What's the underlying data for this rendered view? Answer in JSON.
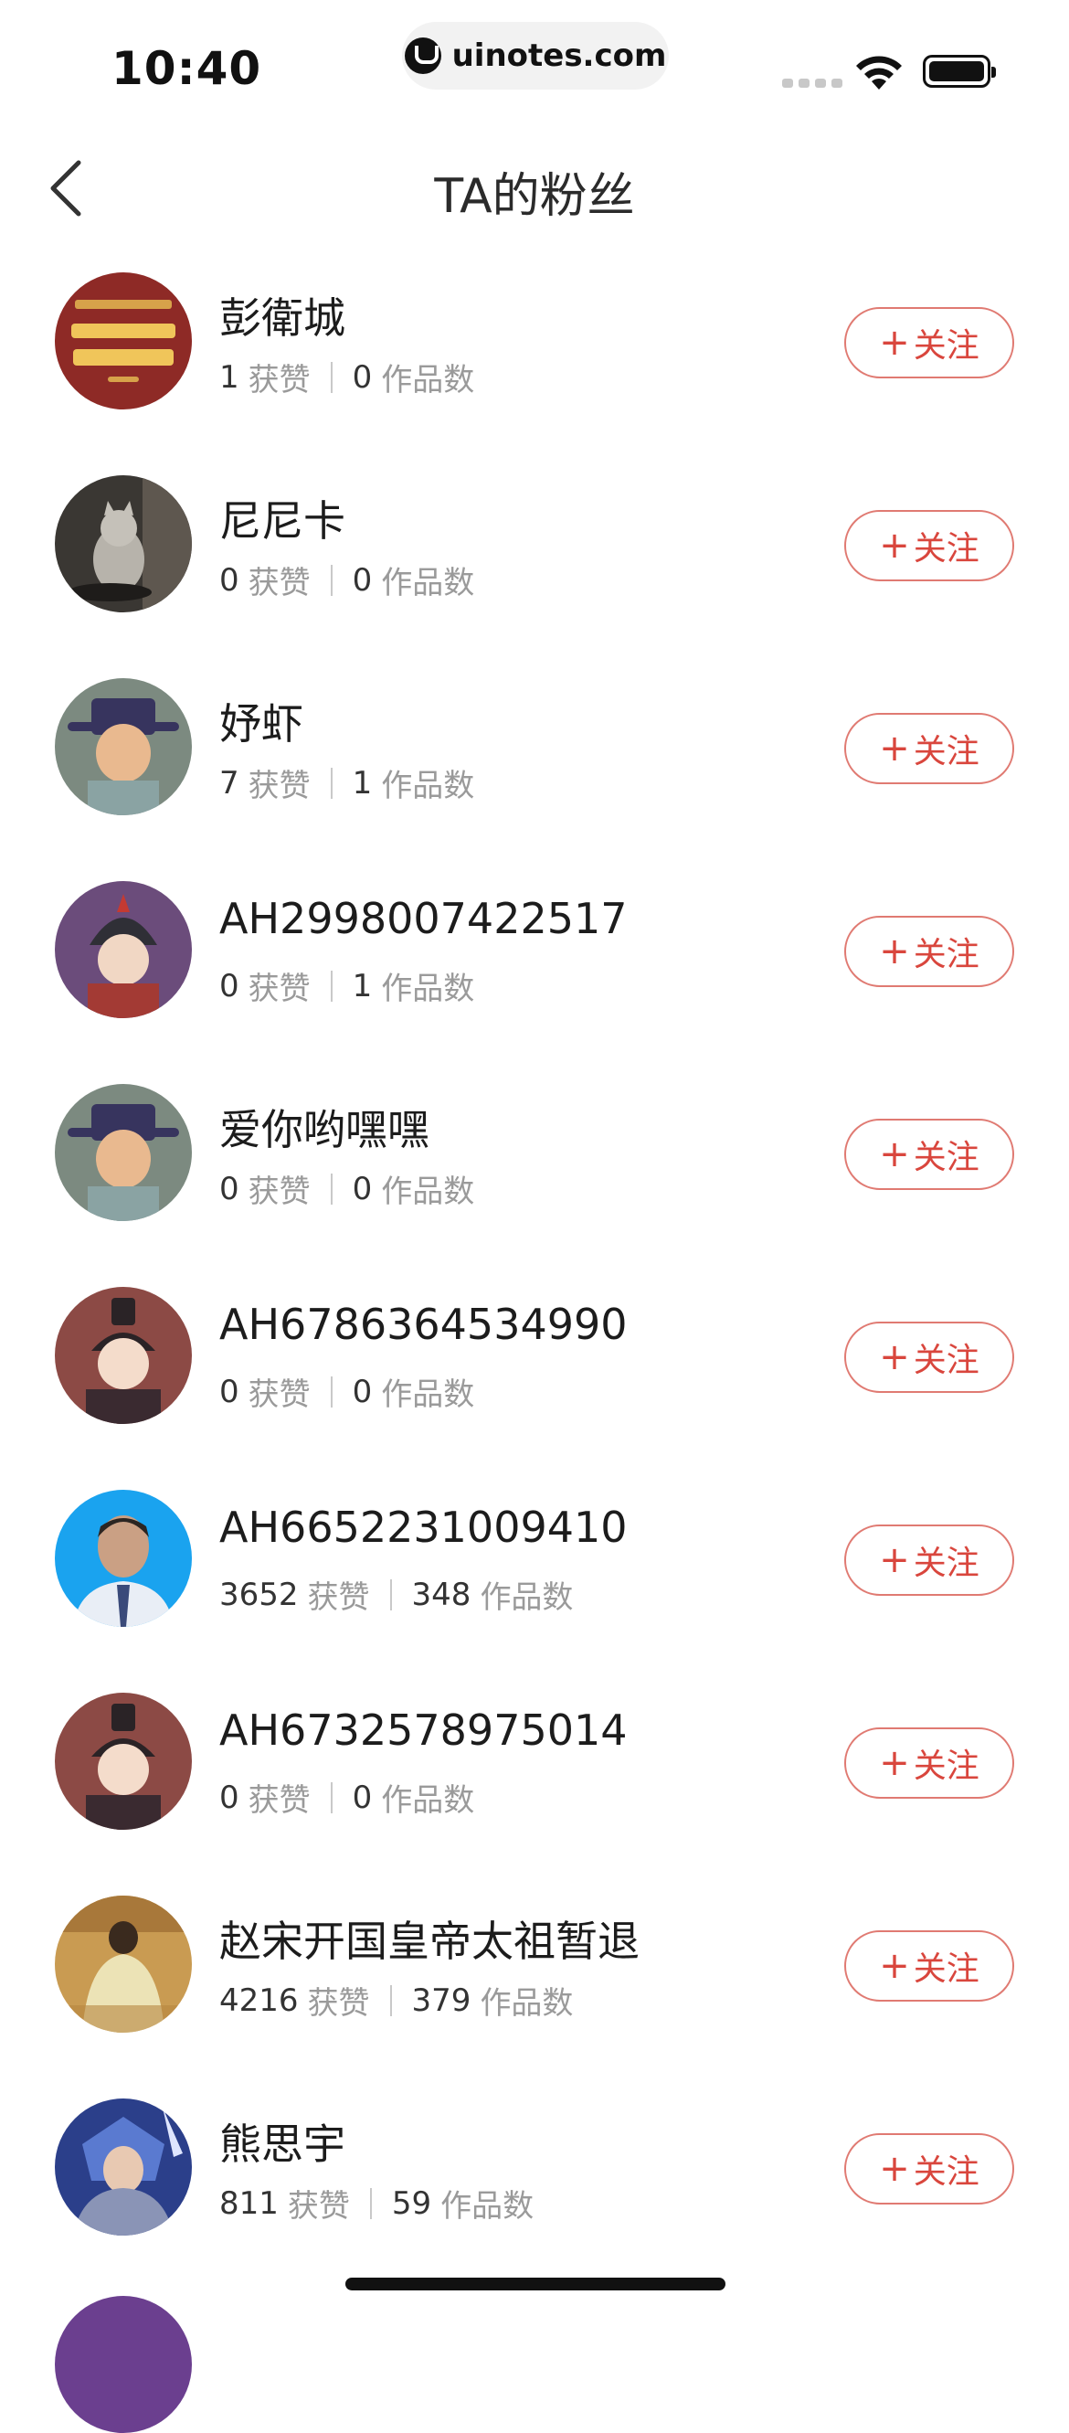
{
  "status_bar": {
    "time": "10:40",
    "url": "uinotes.com"
  },
  "nav": {
    "title": "TA的粉丝"
  },
  "labels": {
    "likes": "获赞",
    "works": "作品数",
    "follow_plus": "+",
    "follow_text": "关注"
  },
  "fans": [
    {
      "name": "彭衛城",
      "likes": "1",
      "works": "0",
      "avatar": "red-card-avatar"
    },
    {
      "name": "尼尼卡",
      "likes": "0",
      "works": "0",
      "avatar": "cat-photo-avatar"
    },
    {
      "name": "妤虾",
      "likes": "7",
      "works": "1",
      "avatar": "cartoon-scholar-avatar"
    },
    {
      "name": "AH2998007422517",
      "likes": "0",
      "works": "1",
      "avatar": "cartoon-warrior-avatar"
    },
    {
      "name": "爱你哟嘿嘿",
      "likes": "0",
      "works": "0",
      "avatar": "cartoon-scholar-avatar"
    },
    {
      "name": "AH6786364534990",
      "likes": "0",
      "works": "0",
      "avatar": "cartoon-official-avatar"
    },
    {
      "name": "AH6652231009410",
      "likes": "3652",
      "works": "348",
      "avatar": "man-photo-avatar"
    },
    {
      "name": "AH6732578975014",
      "likes": "0",
      "works": "0",
      "avatar": "cartoon-official-avatar"
    },
    {
      "name": "赵宋开国皇帝太祖暂退",
      "likes": "4216",
      "works": "379",
      "avatar": "emperor-painting-avatar"
    },
    {
      "name": "熊思宇",
      "likes": "811",
      "works": "59",
      "avatar": "game-hero-avatar"
    }
  ],
  "colors": {
    "accent": "#d9463d",
    "accent_border": "#e07a72",
    "muted": "#9a9a9a"
  }
}
